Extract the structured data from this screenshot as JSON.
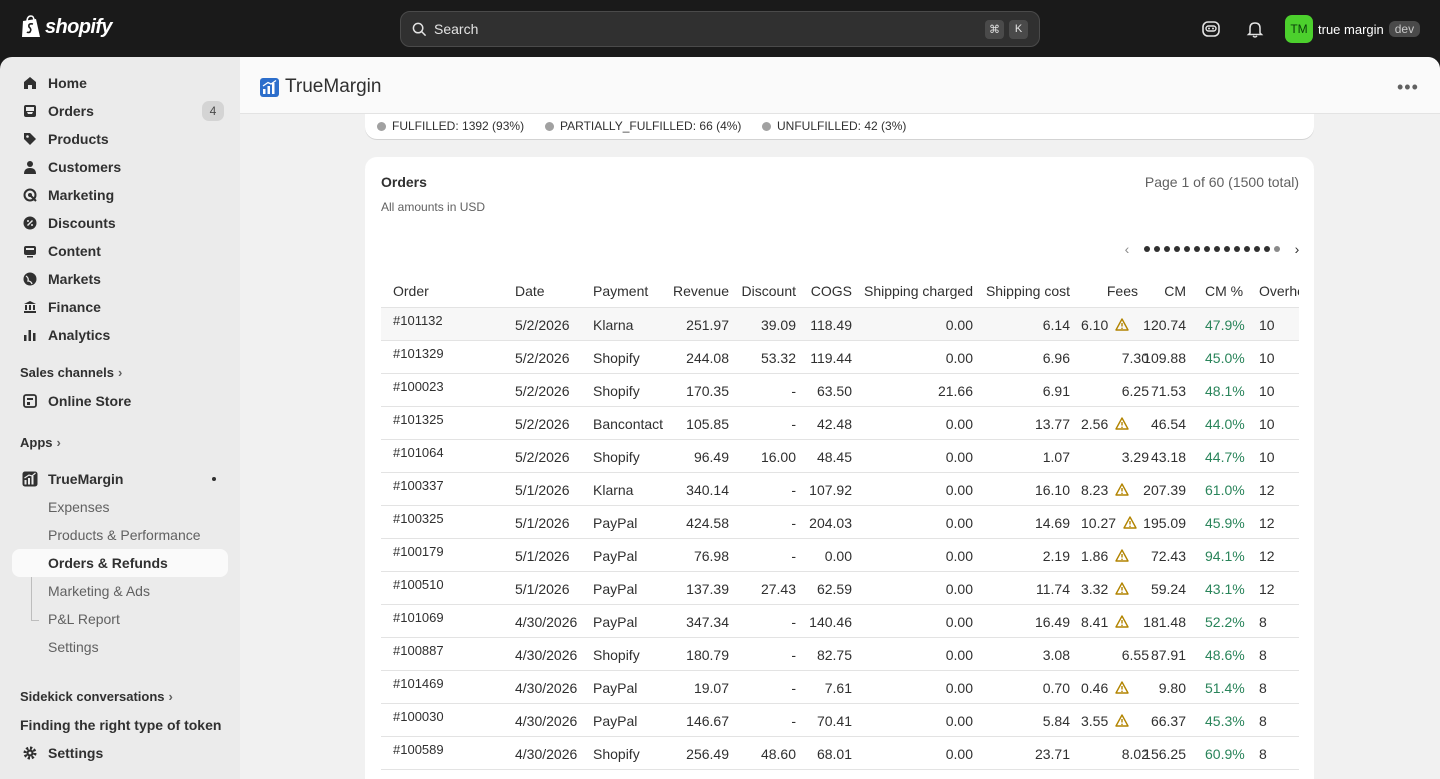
{
  "topbar": {
    "logo_text": "shopify",
    "search_placeholder": "Search",
    "shortcut_key1": "⌘",
    "shortcut_key2": "K",
    "store_initials": "TM",
    "store_name": "true margin",
    "store_badge": "dev"
  },
  "sidebar": {
    "items": [
      {
        "label": "Home",
        "icon": "home-icon"
      },
      {
        "label": "Orders",
        "icon": "orders-icon",
        "badge": "4"
      },
      {
        "label": "Products",
        "icon": "tag-icon"
      },
      {
        "label": "Customers",
        "icon": "person-icon"
      },
      {
        "label": "Marketing",
        "icon": "target-icon"
      },
      {
        "label": "Discounts",
        "icon": "discount-icon"
      },
      {
        "label": "Content",
        "icon": "content-icon"
      },
      {
        "label": "Markets",
        "icon": "globe-icon"
      },
      {
        "label": "Finance",
        "icon": "bank-icon"
      },
      {
        "label": "Analytics",
        "icon": "bar-chart-icon"
      }
    ],
    "sales_channels_label": "Sales channels",
    "online_store_label": "Online Store",
    "apps_label": "Apps",
    "app_name": "TrueMargin",
    "app_subitems": [
      "Expenses",
      "Products & Performance",
      "Orders & Refunds",
      "Marketing & Ads",
      "P&L Report",
      "Settings"
    ],
    "sidekick_label": "Sidekick conversations",
    "sidekick_item": "Finding the right type of token",
    "settings_label": "Settings"
  },
  "app": {
    "title": "TrueMargin",
    "fulfillment": [
      {
        "label": "FULFILLED: 1392 (93%)"
      },
      {
        "label": "PARTIALLY_FULFILLED: 66 (4%)"
      },
      {
        "label": "UNFULFILLED: 42 (3%)"
      }
    ],
    "orders_card": {
      "title": "Orders",
      "subtitle": "All amounts in USD",
      "page_info": "Page 1 of 60 (1500 total)",
      "pagination": {
        "current": 1,
        "total": 60
      },
      "columns": [
        "Order",
        "Date",
        "Payment",
        "Revenue",
        "Discount",
        "COGS",
        "Shipping charged",
        "Shipping cost",
        "Fees",
        "CM",
        "CM %",
        "Overhe"
      ],
      "rows": [
        {
          "order": "#101132",
          "date": "5/2/2026",
          "payment": "Klarna",
          "revenue": "251.97",
          "discount": "39.09",
          "cogs": "118.49",
          "ship_charged": "0.00",
          "ship_cost": "6.14",
          "fees": "6.10",
          "warn": true,
          "cm": "120.74",
          "cm_pct": "47.9%",
          "overhead": "10"
        },
        {
          "order": "#101329",
          "date": "5/2/2026",
          "payment": "Shopify",
          "revenue": "244.08",
          "discount": "53.32",
          "cogs": "119.44",
          "ship_charged": "0.00",
          "ship_cost": "6.96",
          "fees": "7.30",
          "warn": false,
          "cm": "109.88",
          "cm_pct": "45.0%",
          "overhead": "10"
        },
        {
          "order": "#100023",
          "date": "5/2/2026",
          "payment": "Shopify",
          "revenue": "170.35",
          "discount": "-",
          "cogs": "63.50",
          "ship_charged": "21.66",
          "ship_cost": "6.91",
          "fees": "6.25",
          "warn": false,
          "cm": "71.53",
          "cm_pct": "48.1%",
          "overhead": "10"
        },
        {
          "order": "#101325",
          "date": "5/2/2026",
          "payment": "Bancontact",
          "revenue": "105.85",
          "discount": "-",
          "cogs": "42.48",
          "ship_charged": "0.00",
          "ship_cost": "13.77",
          "fees": "2.56",
          "warn": true,
          "cm": "46.54",
          "cm_pct": "44.0%",
          "overhead": "10"
        },
        {
          "order": "#101064",
          "date": "5/2/2026",
          "payment": "Shopify",
          "revenue": "96.49",
          "discount": "16.00",
          "cogs": "48.45",
          "ship_charged": "0.00",
          "ship_cost": "1.07",
          "fees": "3.29",
          "warn": false,
          "cm": "43.18",
          "cm_pct": "44.7%",
          "overhead": "10"
        },
        {
          "order": "#100337",
          "date": "5/1/2026",
          "payment": "Klarna",
          "revenue": "340.14",
          "discount": "-",
          "cogs": "107.92",
          "ship_charged": "0.00",
          "ship_cost": "16.10",
          "fees": "8.23",
          "warn": true,
          "cm": "207.39",
          "cm_pct": "61.0%",
          "overhead": "12"
        },
        {
          "order": "#100325",
          "date": "5/1/2026",
          "payment": "PayPal",
          "revenue": "424.58",
          "discount": "-",
          "cogs": "204.03",
          "ship_charged": "0.00",
          "ship_cost": "14.69",
          "fees": "10.27",
          "warn": true,
          "cm": "195.09",
          "cm_pct": "45.9%",
          "overhead": "12"
        },
        {
          "order": "#100179",
          "date": "5/1/2026",
          "payment": "PayPal",
          "revenue": "76.98",
          "discount": "-",
          "cogs": "0.00",
          "ship_charged": "0.00",
          "ship_cost": "2.19",
          "fees": "1.86",
          "warn": true,
          "cm": "72.43",
          "cm_pct": "94.1%",
          "overhead": "12"
        },
        {
          "order": "#100510",
          "date": "5/1/2026",
          "payment": "PayPal",
          "revenue": "137.39",
          "discount": "27.43",
          "cogs": "62.59",
          "ship_charged": "0.00",
          "ship_cost": "11.74",
          "fees": "3.32",
          "warn": true,
          "cm": "59.24",
          "cm_pct": "43.1%",
          "overhead": "12"
        },
        {
          "order": "#101069",
          "date": "4/30/2026",
          "payment": "PayPal",
          "revenue": "347.34",
          "discount": "-",
          "cogs": "140.46",
          "ship_charged": "0.00",
          "ship_cost": "16.49",
          "fees": "8.41",
          "warn": true,
          "cm": "181.48",
          "cm_pct": "52.2%",
          "overhead": "8"
        },
        {
          "order": "#100887",
          "date": "4/30/2026",
          "payment": "Shopify",
          "revenue": "180.79",
          "discount": "-",
          "cogs": "82.75",
          "ship_charged": "0.00",
          "ship_cost": "3.08",
          "fees": "6.55",
          "warn": false,
          "cm": "87.91",
          "cm_pct": "48.6%",
          "overhead": "8"
        },
        {
          "order": "#101469",
          "date": "4/30/2026",
          "payment": "PayPal",
          "revenue": "19.07",
          "discount": "-",
          "cogs": "7.61",
          "ship_charged": "0.00",
          "ship_cost": "0.70",
          "fees": "0.46",
          "warn": true,
          "cm": "9.80",
          "cm_pct": "51.4%",
          "overhead": "8"
        },
        {
          "order": "#100030",
          "date": "4/30/2026",
          "payment": "PayPal",
          "revenue": "146.67",
          "discount": "-",
          "cogs": "70.41",
          "ship_charged": "0.00",
          "ship_cost": "5.84",
          "fees": "3.55",
          "warn": true,
          "cm": "66.37",
          "cm_pct": "45.3%",
          "overhead": "8"
        },
        {
          "order": "#100589",
          "date": "4/30/2026",
          "payment": "Shopify",
          "revenue": "256.49",
          "discount": "48.60",
          "cogs": "68.01",
          "ship_charged": "0.00",
          "ship_cost": "23.71",
          "fees": "8.02",
          "warn": false,
          "cm": "156.25",
          "cm_pct": "60.9%",
          "overhead": "8"
        }
      ]
    }
  },
  "colors": {
    "accent_green": "#29845a",
    "warning": "#b28400",
    "avatar": "#4cd02d"
  }
}
